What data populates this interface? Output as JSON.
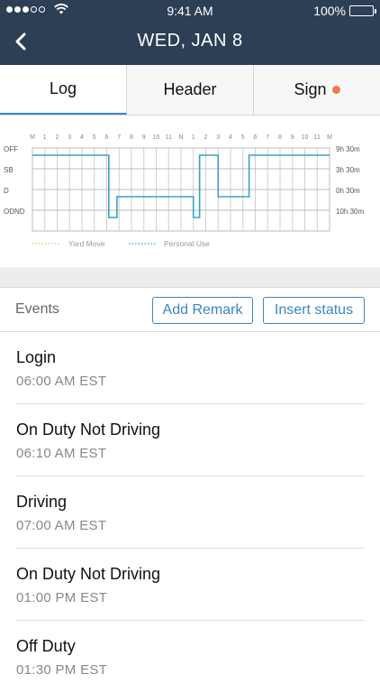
{
  "status_bar": {
    "time": "9:41 AM",
    "battery": "100%",
    "signal_bars_filled": 3,
    "signal_bars_total": 5
  },
  "header": {
    "title": "WED, JAN 8",
    "back_icon": "chevron-left-icon"
  },
  "tabs": [
    {
      "label": "Log",
      "active": true,
      "badge": false
    },
    {
      "label": "Header",
      "active": false,
      "badge": false
    },
    {
      "label": "Sign",
      "active": false,
      "badge": true
    }
  ],
  "colors": {
    "header_bg": "#2d3f55",
    "accent": "#3a86c8",
    "badge": "#ef7a45",
    "log_line": "#3aa0c8",
    "yard_move": "#d6c77a",
    "personal_use": "#3aa0c8"
  },
  "chart_data": {
    "type": "line",
    "hour_labels": [
      "M",
      "1",
      "2",
      "3",
      "4",
      "5",
      "6",
      "7",
      "8",
      "9",
      "10",
      "11",
      "N",
      "1",
      "2",
      "3",
      "4",
      "5",
      "6",
      "7",
      "8",
      "9",
      "10",
      "11",
      "M"
    ],
    "rows": [
      "OFF",
      "SB",
      "D",
      "ODND"
    ],
    "totals": [
      "9h 30m",
      "3h 30m",
      "0h 30m",
      "10h 30m"
    ],
    "legend": [
      {
        "label": "Yard Move",
        "style": "dotted"
      },
      {
        "label": "Personal Use",
        "style": "dotted"
      }
    ],
    "segments": [
      {
        "start": 0,
        "end": 6.17,
        "status": "OFF"
      },
      {
        "start": 6.17,
        "end": 6.83,
        "status": "ODND"
      },
      {
        "start": 6.83,
        "end": 13.0,
        "status": "D"
      },
      {
        "start": 13.0,
        "end": 13.5,
        "status": "ODND"
      },
      {
        "start": 13.5,
        "end": 15.0,
        "status": "OFF"
      },
      {
        "start": 15.0,
        "end": 17.5,
        "status": "D"
      },
      {
        "start": 17.5,
        "end": 24,
        "status": "OFF"
      }
    ]
  },
  "events_bar": {
    "label": "Events",
    "add_remark": "Add Remark",
    "insert_status": "Insert status"
  },
  "events": [
    {
      "name": "Login",
      "time": "06:00 AM EST"
    },
    {
      "name": "On Duty Not Driving",
      "time": "06:10 AM EST"
    },
    {
      "name": "Driving",
      "time": "07:00 AM EST"
    },
    {
      "name": "On Duty Not Driving",
      "time": "01:00 PM EST"
    },
    {
      "name": "Off Duty",
      "time": "01:30 PM EST"
    }
  ]
}
